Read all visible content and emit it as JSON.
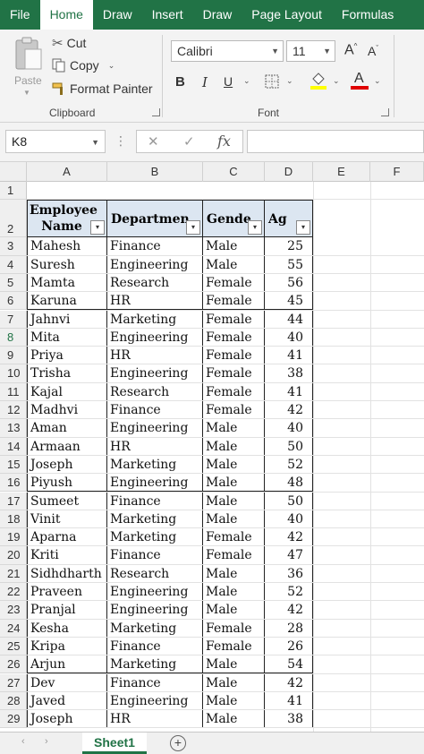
{
  "ribbon_tabs": [
    "File",
    "Home",
    "Draw",
    "Insert",
    "Draw",
    "Page Layout",
    "Formulas"
  ],
  "active_tab": "Home",
  "clipboard": {
    "paste_label": "Paste",
    "cut_label": "Cut",
    "copy_label": "Copy",
    "format_painter_label": "Format Painter",
    "group_label": "Clipboard"
  },
  "font": {
    "name": "Calibri",
    "size": "11",
    "grow_label": "A",
    "shrink_label": "A",
    "bold_label": "B",
    "italic_label": "I",
    "underline_label": "U",
    "font_color_label": "A",
    "group_label": "Font",
    "highlight_color": "#ffff00",
    "font_color": "#e00000"
  },
  "formula_bar": {
    "name_box": "K8",
    "fx_label": "fx",
    "cancel_glyph": "✕",
    "enter_glyph": "✓",
    "value": ""
  },
  "columns": [
    "A",
    "B",
    "C",
    "D",
    "E",
    "F"
  ],
  "header_row": {
    "row_number": "2",
    "cells": [
      "Employee Name",
      "Departmen",
      "Gende",
      "Ag"
    ]
  },
  "rows": [
    {
      "n": "1",
      "cells": null
    },
    {
      "n": "3",
      "cells": [
        "Mahesh",
        "Finance",
        "Male",
        "25"
      ]
    },
    {
      "n": "4",
      "cells": [
        "Suresh",
        "Engineering",
        "Male",
        "55"
      ]
    },
    {
      "n": "5",
      "cells": [
        "Mamta",
        "Research",
        "Female",
        "56"
      ]
    },
    {
      "n": "6",
      "cells": [
        "Karuna",
        "HR",
        "Female",
        "45"
      ]
    },
    {
      "n": "7",
      "cells": [
        "Jahnvi",
        "Marketing",
        "Female",
        "44"
      ]
    },
    {
      "n": "8",
      "cells": [
        "Mita",
        "Engineering",
        "Female",
        "40"
      ]
    },
    {
      "n": "9",
      "cells": [
        "Priya",
        "HR",
        "Female",
        "41"
      ]
    },
    {
      "n": "10",
      "cells": [
        "Trisha",
        "Engineering",
        "Female",
        "38"
      ]
    },
    {
      "n": "11",
      "cells": [
        "Kajal",
        "Research",
        "Female",
        "41"
      ]
    },
    {
      "n": "12",
      "cells": [
        "Madhvi",
        "Finance",
        "Female",
        "42"
      ]
    },
    {
      "n": "13",
      "cells": [
        "Aman",
        "Engineering",
        "Male",
        "40"
      ]
    },
    {
      "n": "14",
      "cells": [
        "Armaan",
        "HR",
        "Male",
        "50"
      ]
    },
    {
      "n": "15",
      "cells": [
        "Joseph",
        "Marketing",
        "Male",
        "52"
      ]
    },
    {
      "n": "16",
      "cells": [
        "Piyush",
        "Engineering",
        "Male",
        "48"
      ]
    },
    {
      "n": "17",
      "cells": [
        "Sumeet",
        "Finance",
        "Male",
        "50"
      ]
    },
    {
      "n": "18",
      "cells": [
        "Vinit",
        "Marketing",
        "Male",
        "40"
      ]
    },
    {
      "n": "19",
      "cells": [
        "Aparna",
        "Marketing",
        "Female",
        "42"
      ]
    },
    {
      "n": "20",
      "cells": [
        "Kriti",
        "Finance",
        "Female",
        "47"
      ]
    },
    {
      "n": "21",
      "cells": [
        "Sidhdharth",
        "Research",
        "Male",
        "36"
      ]
    },
    {
      "n": "22",
      "cells": [
        "Praveen",
        "Engineering",
        "Male",
        "52"
      ]
    },
    {
      "n": "23",
      "cells": [
        "Pranjal",
        "Engineering",
        "Male",
        "42"
      ]
    },
    {
      "n": "24",
      "cells": [
        "Kesha",
        "Marketing",
        "Female",
        "28"
      ]
    },
    {
      "n": "25",
      "cells": [
        "Kripa",
        "Finance",
        "Female",
        "26"
      ]
    },
    {
      "n": "26",
      "cells": [
        "Arjun",
        "Marketing",
        "Male",
        "54"
      ]
    },
    {
      "n": "27",
      "cells": [
        "Dev",
        "Finance",
        "Male",
        "42"
      ]
    },
    {
      "n": "28",
      "cells": [
        "Javed",
        "Engineering",
        "Male",
        "41"
      ]
    },
    {
      "n": "29",
      "cells": [
        "Joseph",
        "HR",
        "Male",
        "38"
      ]
    }
  ],
  "selected_row": "8",
  "sheet_tabs": [
    "Sheet1"
  ],
  "add_sheet_glyph": "+",
  "accent_color": "#217346",
  "header_fill": "#dce6f1"
}
